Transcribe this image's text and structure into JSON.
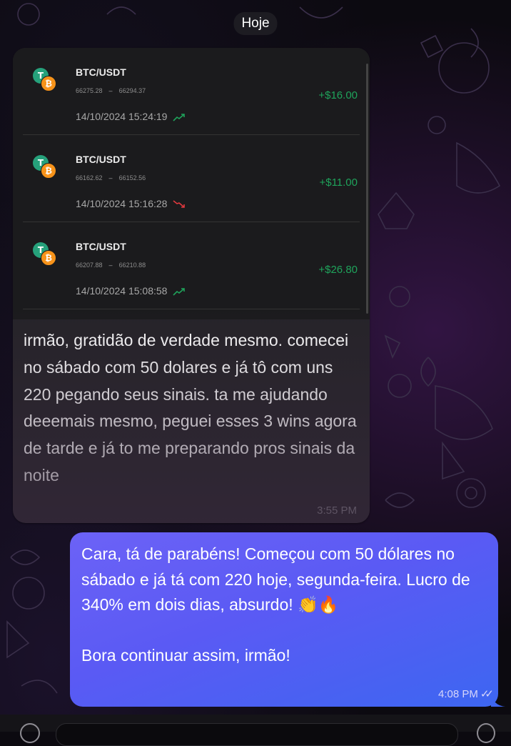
{
  "chat": {
    "date_separator": "Hoje",
    "incoming": {
      "trades": [
        {
          "pair": "BTC/USDT",
          "open_price": "66275.28",
          "separator": "–",
          "close_price": "66294.37",
          "datetime": "14/10/2024 15:24:19",
          "trend": "up",
          "profit": "+$16.00"
        },
        {
          "pair": "BTC/USDT",
          "open_price": "66162.62",
          "separator": "–",
          "close_price": "66152.56",
          "datetime": "14/10/2024 15:16:28",
          "trend": "down",
          "profit": "+$11.00"
        },
        {
          "pair": "BTC/USDT",
          "open_price": "66207.88",
          "separator": "–",
          "close_price": "66210.88",
          "datetime": "14/10/2024 15:08:58",
          "trend": "up",
          "profit": "+$26.80"
        }
      ],
      "text": "irmão, gratidão de verdade mesmo. comecei no sábado com 50 dolares e já tô com uns 220 pegando seus sinais. ta me ajudando deeemais mesmo, peguei esses 3 wins agora de tarde e já to me preparando pros sinais da noite",
      "time": "3:55 PM"
    },
    "outgoing": {
      "line1": "Cara, tá de parabéns! Começou com 50 dólares no sábado e já tá com 220 hoje, segunda-feira. Lucro de 340% em dois dias, absurdo! 👏🔥",
      "line2": "Bora continuar assim, irmão!",
      "time": "4:08 PM",
      "status_icon": "double-check-icon"
    }
  },
  "colors": {
    "profit_green": "#1fa35b",
    "trend_down_red": "#e0393e",
    "outgoing_bubble": "#5a5af4",
    "incoming_bubble": "#262429"
  }
}
